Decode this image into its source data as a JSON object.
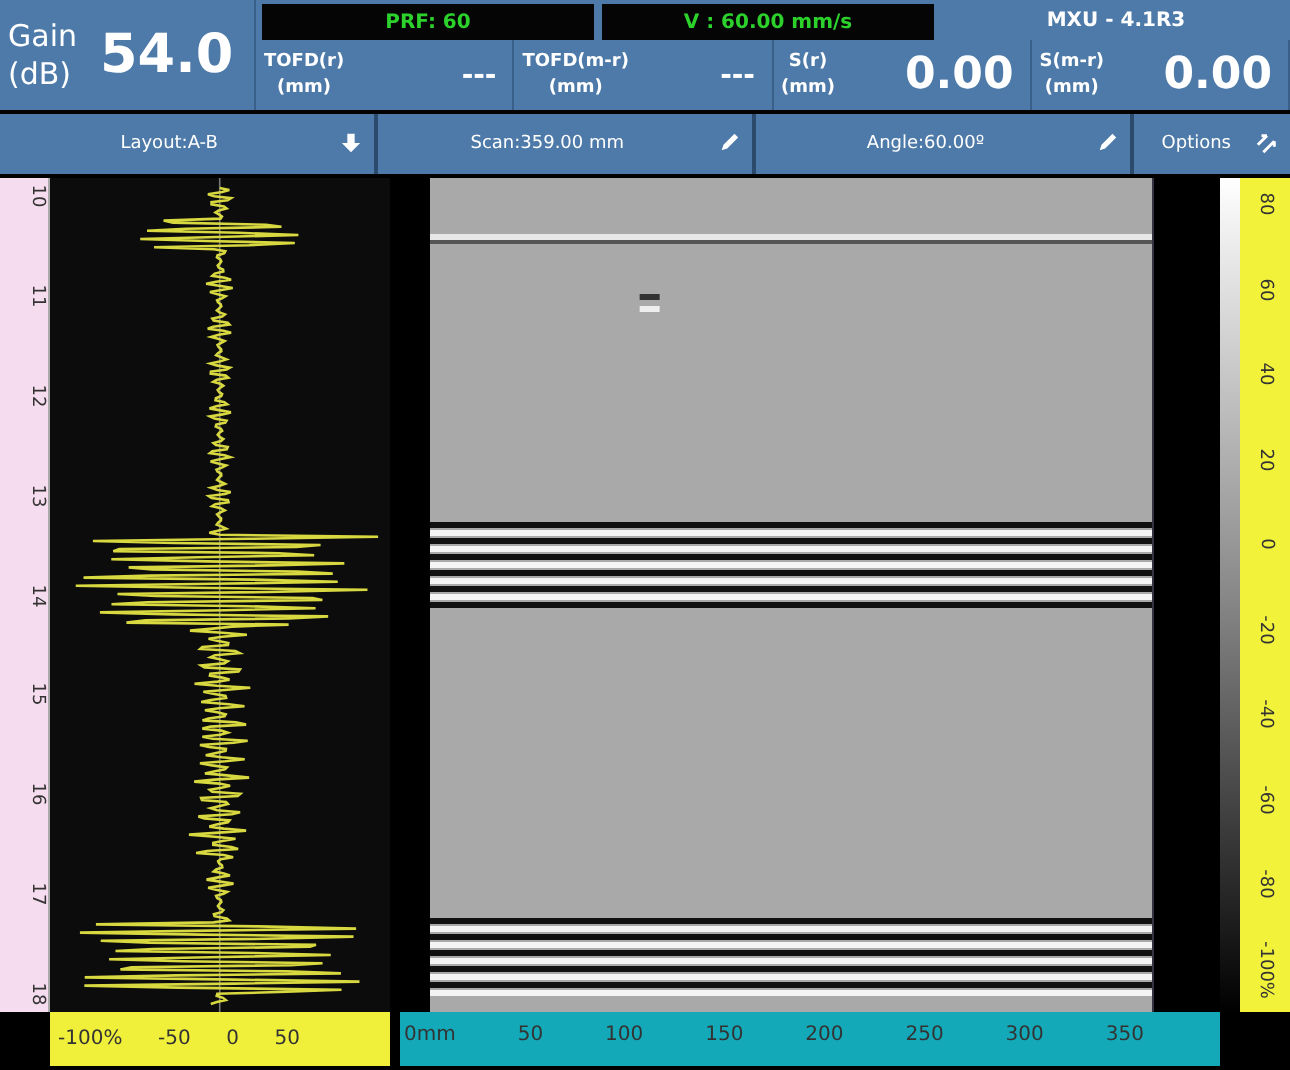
{
  "header": {
    "gain": {
      "label": "Gain (dB)",
      "value": "54.0"
    },
    "status": [
      {
        "text": "PRF: 60"
      },
      {
        "text": "V : 60.00 mm/s"
      }
    ],
    "probe": "MXU - 4.1R3",
    "readings": [
      {
        "label": "TOFD(r)",
        "unit": "(mm)",
        "value": "---"
      },
      {
        "label": "TOFD(m-r)",
        "unit": "(mm)",
        "value": "---"
      },
      {
        "label": "S(r)",
        "unit": "(mm)",
        "value": "0.00"
      },
      {
        "label": "S(m-r)",
        "unit": "(mm)",
        "value": "0.00"
      }
    ]
  },
  "toolbar": [
    {
      "label": "Layout:A-B",
      "kind": "down"
    },
    {
      "label": "Scan:359.00 mm",
      "kind": "pencil"
    },
    {
      "label": "Angle:60.00º",
      "kind": "pencil"
    },
    {
      "label": "Options",
      "kind": "arrows"
    }
  ],
  "time_ruler": {
    "labels": [
      "10",
      "11",
      "12",
      "13",
      "14",
      "15",
      "16",
      "17",
      "18"
    ]
  },
  "amplitude_scale": {
    "labels": [
      "80",
      "60",
      "40",
      "20",
      "0",
      "-20",
      "-40",
      "-60",
      "-80",
      "-100%"
    ]
  },
  "a_scan_axis": {
    "labels": [
      "-100%",
      "-50",
      "0",
      "50"
    ]
  },
  "scan_axis": {
    "labels": [
      "0mm",
      "50",
      "100",
      "150",
      "200",
      "250",
      "300",
      "350"
    ]
  }
}
